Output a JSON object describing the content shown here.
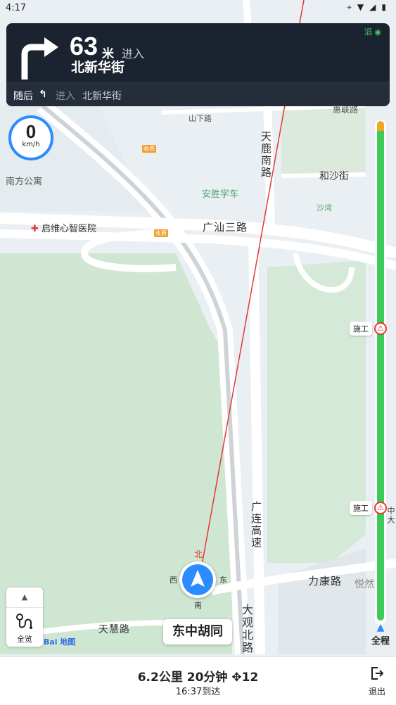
{
  "status_bar": {
    "time": "4:17"
  },
  "maneuver": {
    "distance": "63",
    "unit": "米",
    "enter_label": "进入",
    "road": "北新华街",
    "gps_badge": "滔"
  },
  "next_step": {
    "then_label": "随后",
    "enter_label": "进入",
    "road": "北新华街"
  },
  "speed": {
    "value": "0",
    "unit": "km/h"
  },
  "map_labels": {
    "shanxia_road": "山下路",
    "huilian_road": "惠联路",
    "tianlu_south": "天鹿南路",
    "heshajie": "和沙街",
    "nanfang_gongyu": "南方公寓",
    "ansheng": "安胜学车",
    "shawan": "沙湾",
    "hospital": "启维心智医院",
    "guangshan_3": "广汕三路",
    "toll1": "收费",
    "toll2": "收费",
    "guanglian": "广连高速",
    "likang_road": "力康路",
    "yueran": "悦然",
    "tianhui_road": "天慧路",
    "daguan_north": "大观北路",
    "right_edge": "中大"
  },
  "compass": {
    "north": "北",
    "south": "南",
    "east": "东",
    "west": "西"
  },
  "route_progress": {
    "completed_fraction": 0.02,
    "construction_1": "施工",
    "construction_2": "施工"
  },
  "controls": {
    "overview_label": "全览",
    "full_route_label": "全程"
  },
  "current_street": "东中胡同",
  "logo": "Bai 地图",
  "trip_summary": {
    "distance": "6.2公里",
    "duration": "20分钟",
    "traffic_lights": "12",
    "eta": "16:37到达"
  },
  "exit_label": "退出",
  "colors": {
    "route_green": "#3ccb5b",
    "nav_card": "#1c2330",
    "accent_blue": "#2a8cff",
    "guide_line": "#e53935"
  }
}
